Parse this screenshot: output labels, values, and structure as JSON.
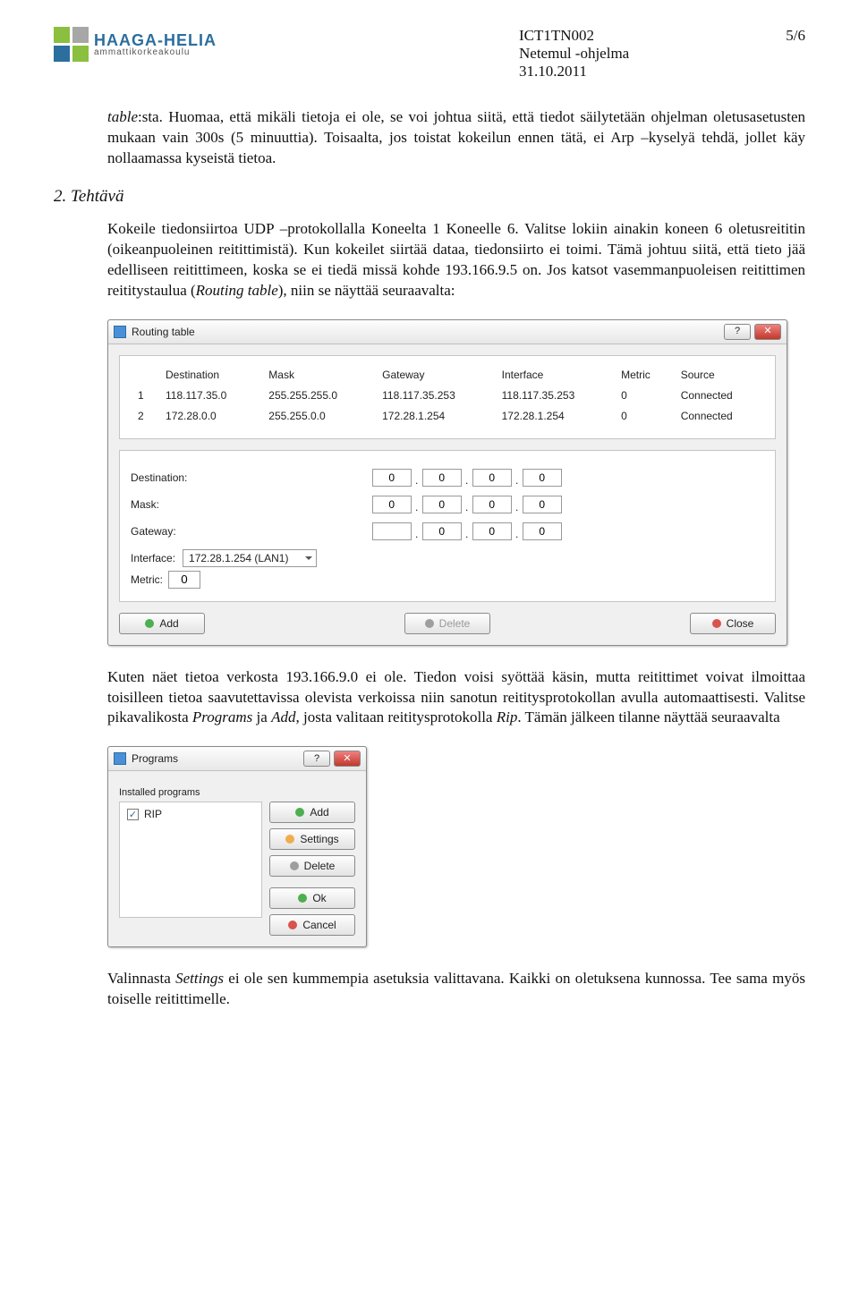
{
  "header": {
    "brand_main": "HAAGA-HELIA",
    "brand_sub": "ammattikorkeakoulu",
    "code": "ICT1TN002",
    "title": "Netemul -ohjelma",
    "date": "31.10.2011",
    "page": "5/6"
  },
  "para1a": "table",
  "para1b": ":sta. Huomaa, että mikäli tietoja ei ole, se voi johtua siitä, että tiedot säilytetään ohjelman oletusasetusten mukaan vain 300s (5 minuuttia). Toisaalta, jos toistat kokeilun ennen tätä, ei Arp –kyselyä tehdä, jollet käy nollaamassa kyseistä tietoa.",
  "section": "2. Tehtävä",
  "para2a": "Kokeile tiedonsiirtoa UDP –protokollalla Koneelta 1 Koneelle 6. Valitse lokiin ainakin koneen 6 oletusreititin (oikeanpuoleinen reitittimistä). Kun kokeilet siirtää dataa, tiedonsiirto ei toimi. Tämä johtuu siitä, että tieto jää edelliseen reitittimeen, koska se ei tiedä missä kohde 193.166.9.5 on. Jos katsot vasemmanpuoleisen reitittimen reititystaulua (",
  "para2b": "Routing table",
  "para2c": "), niin se näyttää seuraavalta:",
  "routing": {
    "title": "Routing table",
    "help_icon": "?",
    "close_icon": "✕",
    "cols": [
      "",
      "Destination",
      "Mask",
      "Gateway",
      "Interface",
      "Metric",
      "Source"
    ],
    "rows": [
      [
        "1",
        "118.117.35.0",
        "255.255.255.0",
        "118.117.35.253",
        "118.117.35.253",
        "0",
        "Connected"
      ],
      [
        "2",
        "172.28.0.0",
        "255.255.0.0",
        "172.28.1.254",
        "172.28.1.254",
        "0",
        "Connected"
      ]
    ],
    "dest_label": "Destination:",
    "mask_label": "Mask:",
    "gw_label": "Gateway:",
    "iface_label": "Interface:",
    "iface_val": "172.28.1.254 (LAN1)",
    "metric_label": "Metric:",
    "metric_val": "0",
    "dest_v": [
      "0",
      "0",
      "0",
      "0"
    ],
    "mask_v": [
      "0",
      "0",
      "0",
      "0"
    ],
    "gw_v": [
      "",
      "0",
      "0",
      "0"
    ],
    "btn_add": "Add",
    "btn_del": "Delete",
    "btn_close": "Close"
  },
  "para3a": "Kuten näet tietoa verkosta 193.166.9.0 ei ole. Tiedon voisi syöttää käsin, mutta reitittimet voivat ilmoittaa toisilleen tietoa saavutettavissa olevista verkoissa niin sanotun reititysprotokollan avulla automaattisesti. Valitse pikavalikosta ",
  "para3b": "Programs",
  "para3c": " ja ",
  "para3d": "Add",
  "para3e": ", josta valitaan reititysprotokolla ",
  "para3f": "Rip",
  "para3g": ". Tämän jälkeen tilanne näyttää seuraavalta",
  "programs": {
    "title": "Programs",
    "installed": "Installed programs",
    "item": "RIP",
    "btn_add": "Add",
    "btn_settings": "Settings",
    "btn_delete": "Delete",
    "btn_ok": "Ok",
    "btn_cancel": "Cancel",
    "help_icon": "?",
    "close_icon": "✕"
  },
  "para4a": "Valinnasta ",
  "para4b": "Settings",
  "para4c": " ei ole sen kummempia asetuksia valittavana. Kaikki on oletuksena kunnossa. Tee sama myös toiselle reitittimelle."
}
